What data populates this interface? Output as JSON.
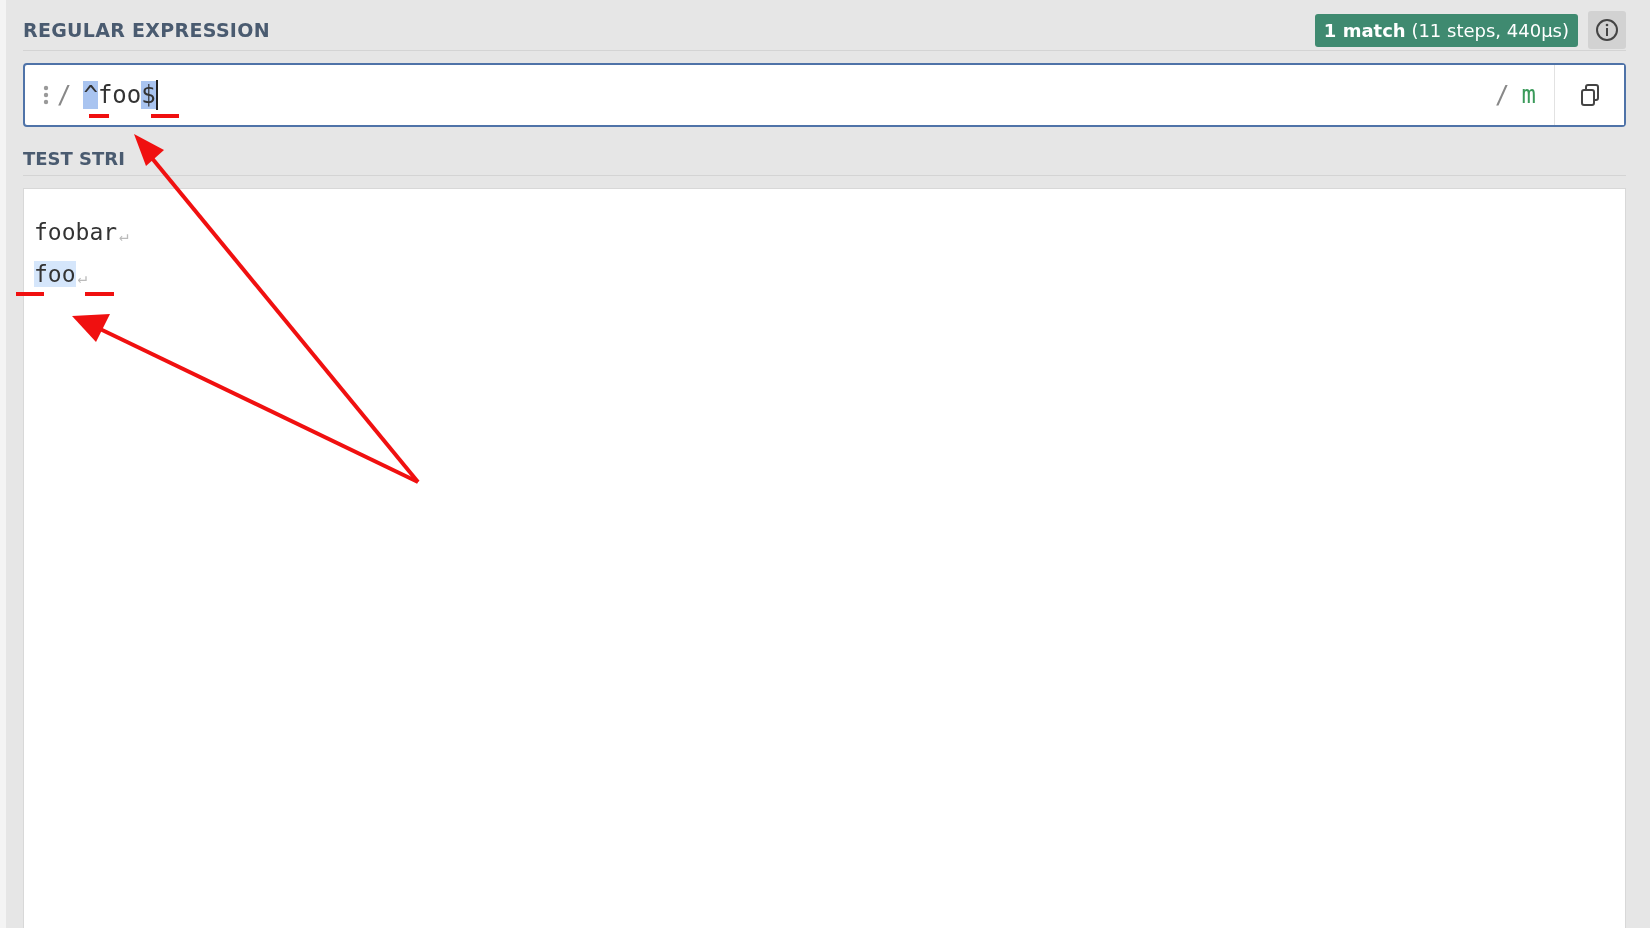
{
  "regex_section": {
    "label": "REGULAR EXPRESSION",
    "match_badge": {
      "main": "1 match",
      "detail": "(11 steps, 440µs)"
    },
    "delimiter_open": "/",
    "tokens": [
      {
        "text": "^",
        "kind": "anchor"
      },
      {
        "text": "foo",
        "kind": "literal"
      },
      {
        "text": "$",
        "kind": "anchor"
      }
    ],
    "delimiter_close": "/",
    "flags": "m"
  },
  "test_section": {
    "label": "TEST STRI",
    "lines": [
      {
        "text": "foobar",
        "matched": false,
        "eol": "↵"
      },
      {
        "text": "foo",
        "matched": true,
        "eol": "↵"
      }
    ]
  }
}
